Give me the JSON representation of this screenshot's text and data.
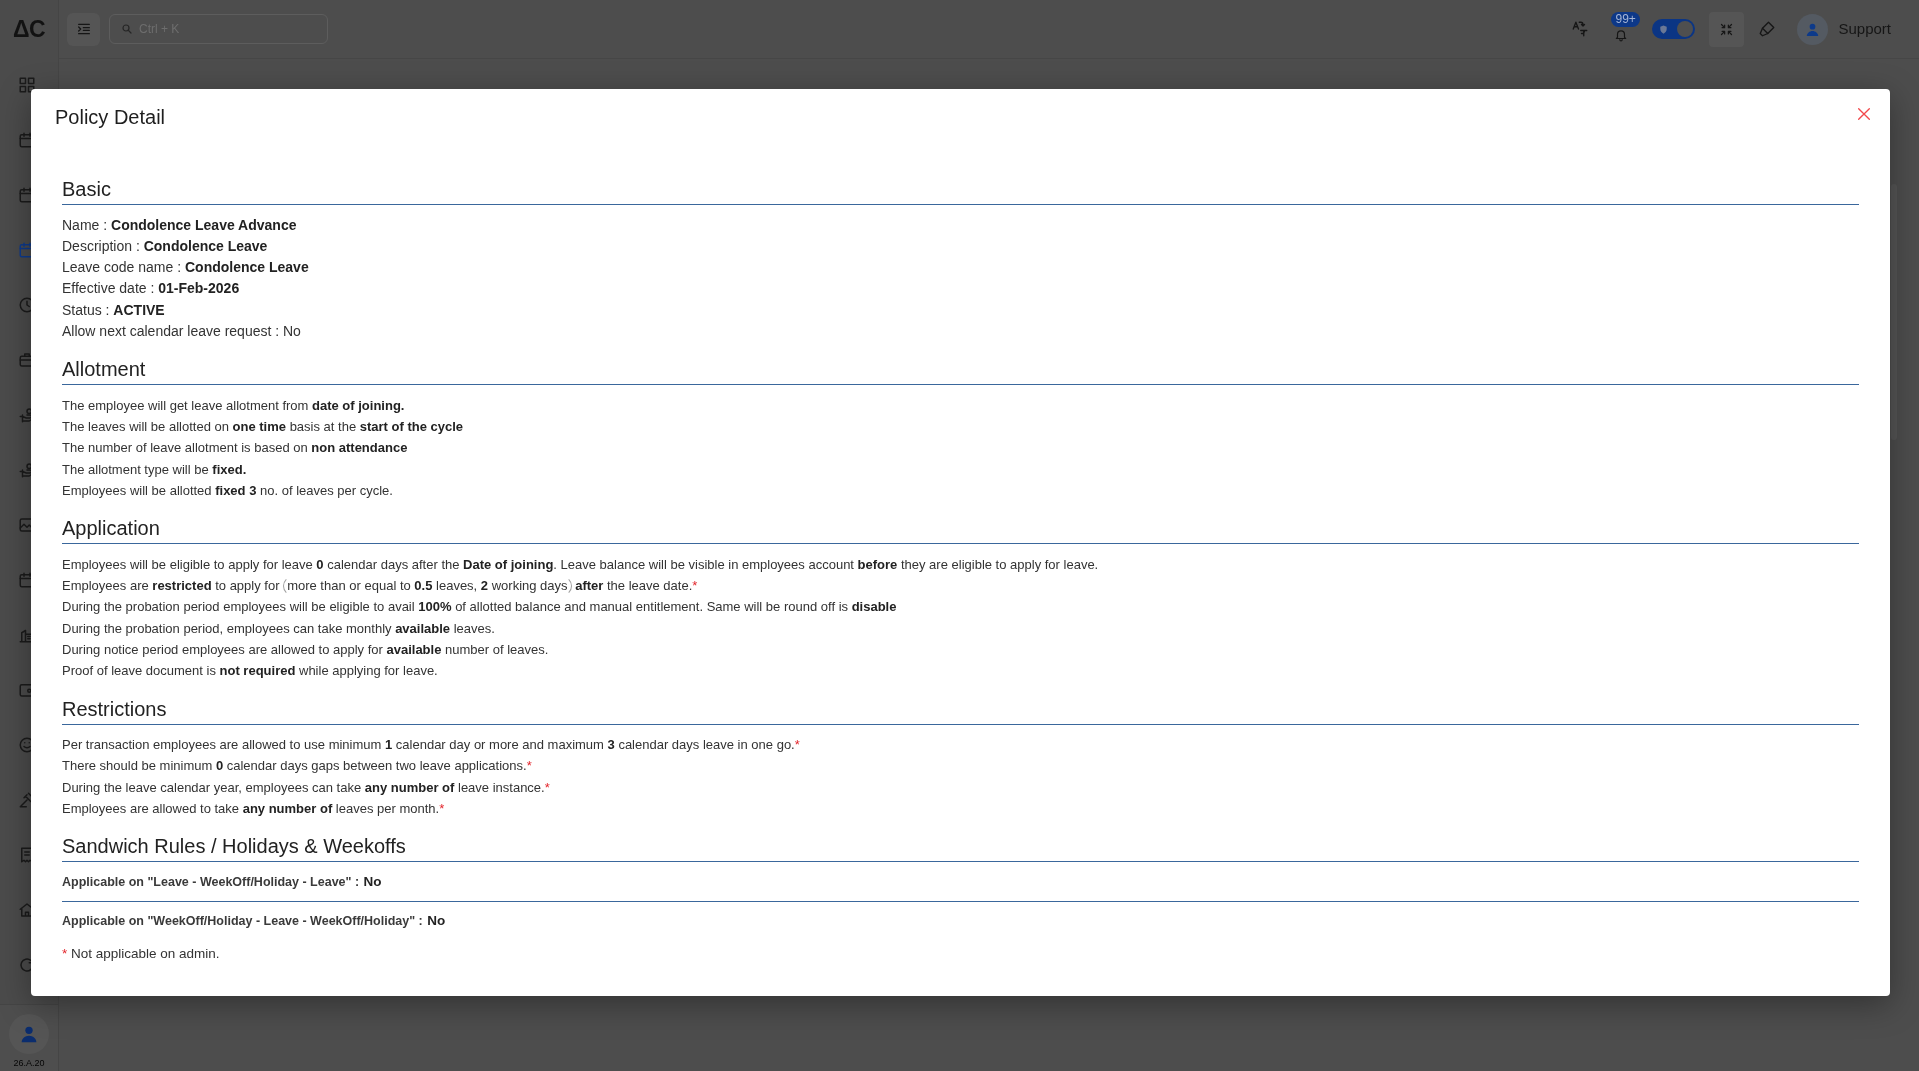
{
  "sidebar": {
    "logo": "ΔC",
    "items": [
      {
        "selected": false
      },
      {
        "selected": false
      },
      {
        "selected": false
      },
      {
        "selected": true
      },
      {
        "selected": false
      },
      {
        "selected": false
      },
      {
        "selected": false
      },
      {
        "selected": false
      },
      {
        "selected": false
      },
      {
        "selected": false
      },
      {
        "selected": false
      },
      {
        "selected": false
      },
      {
        "selected": false
      },
      {
        "selected": false
      },
      {
        "selected": false
      },
      {
        "selected": false
      },
      {
        "selected": false
      }
    ],
    "user": {
      "version": "26.A.20"
    }
  },
  "topbar": {
    "search": {
      "placeholder": "Ctrl + K"
    },
    "notifications": {
      "badge": "99+"
    },
    "theme_toggle": {
      "on": true
    },
    "user": {
      "name": "Support"
    }
  },
  "modal": {
    "title": "Policy Detail",
    "sections": [
      {
        "title": "Basic",
        "kind": "fields",
        "lines": [
          {
            "text": "Name : **Condolence Leave Advance**"
          },
          {
            "text": "Description : **Condolence Leave**"
          },
          {
            "text": "Leave code name : **Condolence Leave**"
          },
          {
            "text": "Effective date : **01-Feb-2026**"
          },
          {
            "text": "Status : **ACTIVE**"
          },
          {
            "text": "Allow next calendar leave request : No"
          }
        ]
      },
      {
        "title": "Allotment",
        "kind": "statements",
        "lines": [
          {
            "text": "The employee will get leave allotment from **date of joining.**"
          },
          {
            "text": "The leaves will be allotted on **one time** basis at the **start of the cycle**"
          },
          {
            "text": "The number of leave allotment is based on **non attendance**"
          },
          {
            "text": "The allotment type will be **fixed.**"
          },
          {
            "text": "Employees will be allotted **fixed 3** no. of leaves per cycle."
          }
        ]
      },
      {
        "title": "Application",
        "kind": "statements",
        "lines": [
          {
            "text": "Employees will be eligible to apply for leave **0** calendar days after the **Date of joining**. Leave balance will be visible in employees account **before** they are eligible to apply for leave."
          },
          {
            "text": "Employees are **restricted** to apply for",
            "bracketed": "more than or equal to **0.5** leaves, **2** working days",
            "text_after": "**after** the leave date.",
            "note_mark": "*"
          },
          {
            "text": "During the probation period employees will be eligible to avail **100%** of allotted balance and manual entitlement. Same will be round off is **disable**"
          },
          {
            "text": "During the probation period, employees can take monthly **available** leaves."
          },
          {
            "text": "During notice period employees are allowed to apply for **available** number of leaves."
          },
          {
            "text": "Proof of leave document is **not required** while applying for leave."
          }
        ]
      },
      {
        "title": "Restrictions",
        "kind": "statements",
        "lines": [
          {
            "text": "Per transaction employees are allowed to use minimum **1** calendar day or more and maximum **3** calendar days leave in one go.",
            "note_mark": "*"
          },
          {
            "text": "There should be minimum **0** calendar days gaps between two leave applications.",
            "note_mark": "*"
          },
          {
            "text": "During the leave calendar year, employees can take **any number of** leave instance.",
            "note_mark": "*"
          },
          {
            "text": "Employees are allowed to take **any number of** leaves per month.",
            "note_mark": "*"
          }
        ]
      },
      {
        "title": "Sandwich Rules / Holidays & Weekoffs",
        "kind": "rules",
        "rules": [
          {
            "label": "Applicable on \"Leave - WeekOff/Holiday - Leave\" :",
            "value": "No"
          },
          {
            "label": "Applicable on \"WeekOff/Holiday - Leave - WeekOff/Holiday\" :",
            "value": "No"
          }
        ]
      }
    ],
    "footnote": {
      "mark": "*",
      "text": "Not applicable on admin."
    }
  }
}
